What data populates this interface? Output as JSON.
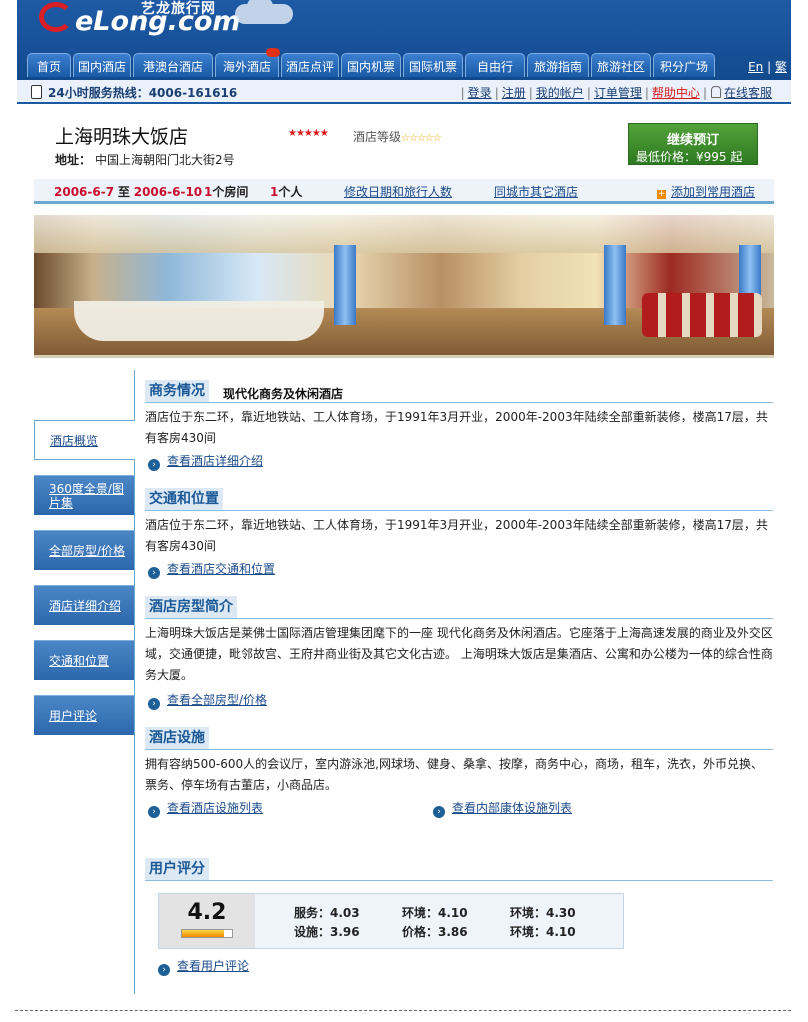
{
  "header": {
    "logo_cn": "艺龙旅行网",
    "logo_en": "eLong.com",
    "nav": [
      "首页",
      "国内酒店",
      "港澳台酒店",
      "海外酒店",
      "酒店点评",
      "国内机票",
      "国际机票",
      "自由行",
      "旅游指南",
      "旅游社区",
      "积分广场"
    ],
    "lang_en": "En",
    "lang_sep": "|",
    "lang_trad": "繁",
    "hotline_label": "24小时服务热线：",
    "hotline_number": "4006-161616",
    "user_links": {
      "login": "登录",
      "register": "注册",
      "my_account": "我的帐户",
      "orders": "订单管理",
      "help": "帮助中心",
      "online_service": "在线客服"
    }
  },
  "hotel": {
    "name": "上海明珠大饭店",
    "stars": "★★★★★",
    "grade_label": "酒店等级",
    "grade_stars": "☆☆☆☆☆",
    "address_label": "地址：",
    "address": "中国上海朝阳门北大街2号",
    "book_button": "继续预订",
    "min_price_label": "最低价格：",
    "min_price": "¥995 起"
  },
  "datebar": {
    "checkin": "2006-6-7",
    "to": "至",
    "checkout": "2006-6-10",
    "rooms_num": "1",
    "rooms_text": "个房间",
    "people_num": "1",
    "people_text": "个人",
    "modify_link": "修改日期和旅行人数",
    "nearby_link": "同城市其它酒店",
    "add_fav": "添加到常用酒店"
  },
  "sidebar": [
    "酒店概览",
    "360度全景/图片集",
    "全部房型/价格",
    "酒店详细介绍",
    "交通和位置",
    "用户评论"
  ],
  "sections": {
    "business": {
      "title": "商务情况",
      "subtitle": "现代化商务及休闲酒店",
      "text": "酒店位于东二环，靠近地铁站、工人体育场，于1991年3月开业，2000年-2003年陆续全部重新装修，楼高17层，共有客房430间",
      "link": "查看酒店详细介绍"
    },
    "transport": {
      "title": "交通和位置",
      "text": "酒店位于东二环，靠近地铁站、工人体育场，于1991年3月开业，2000年-2003年陆续全部重新装修，楼高17层，共有客房430间",
      "link": "查看酒店交通和位置"
    },
    "rooms": {
      "title": "酒店房型简介",
      "text": "上海明珠大饭店是莱佛士国际酒店管理集团麾下的一座 现代化商务及休闲酒店。它座落于上海高速发展的商业及外交区域，交通便捷，毗邻故宫、王府井商业街及其它文化古迹。 上海明珠大饭店是集酒店、公寓和办公楼为一体的综合性商务大厦。",
      "link": "查看全部房型/价格"
    },
    "facilities": {
      "title": "酒店设施",
      "text": "拥有容纳500-600人的会议厅，室内游泳池,网球场、健身、桑拿、按摩，商务中心，商场，租车，洗衣，外币兑换、票务、停车场有古董店，小商品店。",
      "link1": "查看酒店设施列表",
      "link2": "查看内部康体设施列表"
    },
    "rating": {
      "title": "用户评分",
      "score": "4.2",
      "score_fraction": 0.84,
      "items": [
        {
          "label": "服务：",
          "value": "4.03"
        },
        {
          "label": "环境：",
          "value": "4.10"
        },
        {
          "label": "环境：",
          "value": "4.30"
        },
        {
          "label": "设施：",
          "value": "3.96"
        },
        {
          "label": "价格：",
          "value": "3.86"
        },
        {
          "label": "环境：",
          "value": "4.10"
        }
      ],
      "link": "查看用户评论"
    }
  },
  "colors": {
    "header_blue": "#124a8e",
    "accent_red": "#c8102e",
    "book_green": "#2e7a22",
    "section_blue": "#1a5896"
  }
}
